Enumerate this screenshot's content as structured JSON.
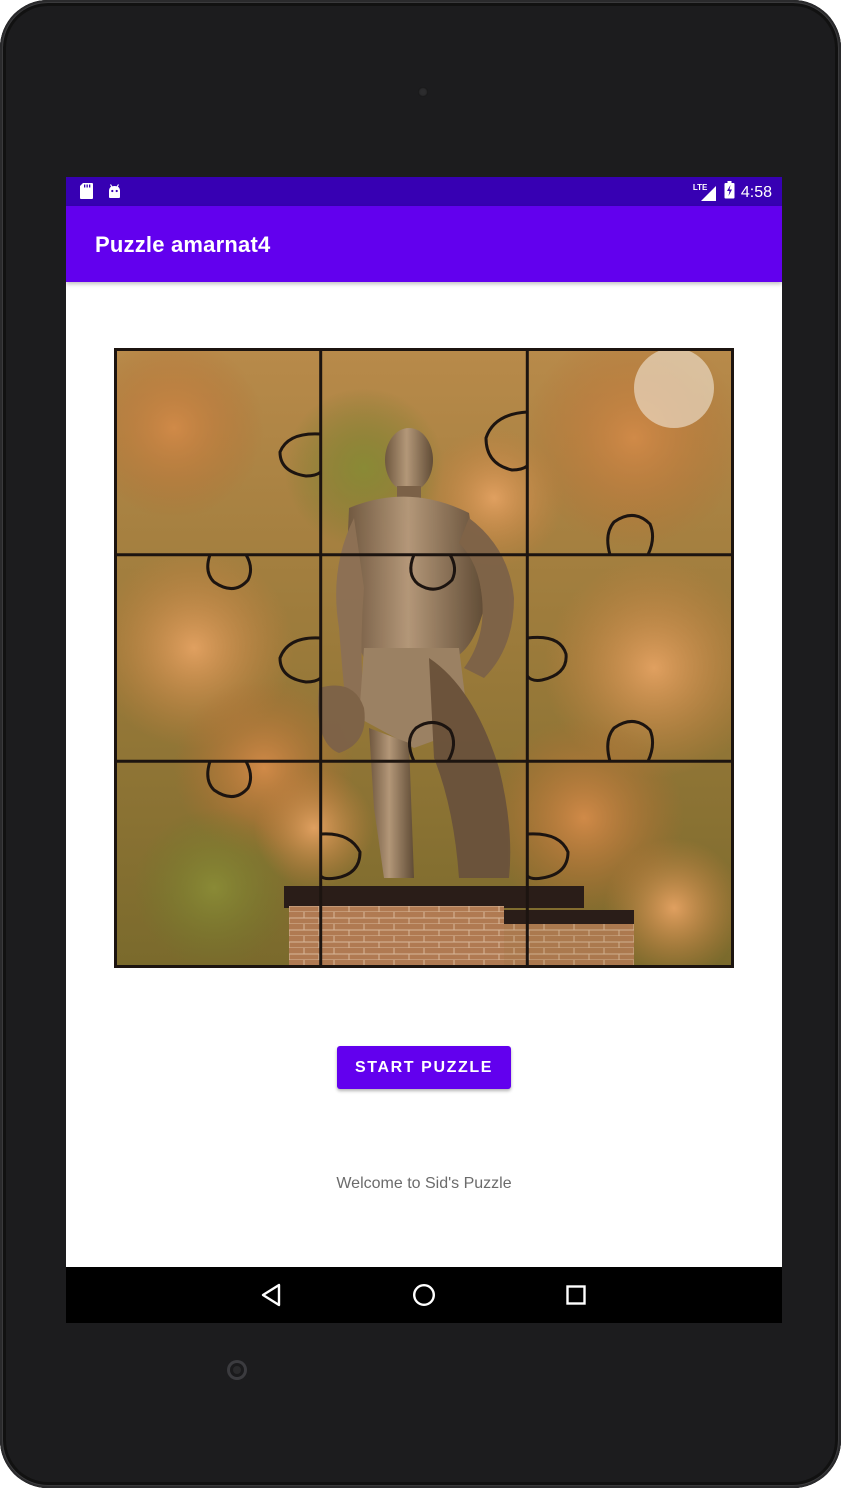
{
  "status_bar": {
    "time": "4:58",
    "network": "LTE",
    "left_icons": [
      "sd-card-icon",
      "android-icon"
    ],
    "right_icons": [
      "signal-icon",
      "battery-icon"
    ]
  },
  "app_bar": {
    "title": "Puzzle amarnat4"
  },
  "puzzle": {
    "rows": 3,
    "cols": 3
  },
  "main": {
    "start_button_label": "START PUZZLE",
    "welcome_text": "Welcome to Sid's Puzzle"
  },
  "nav_bar": {
    "buttons": [
      "back-icon",
      "home-icon",
      "recents-icon"
    ]
  },
  "colors": {
    "primary": "#6200ee",
    "primary_dark": "#3700b3",
    "nav": "#000000",
    "text_secondary": "#6b6b6b"
  }
}
